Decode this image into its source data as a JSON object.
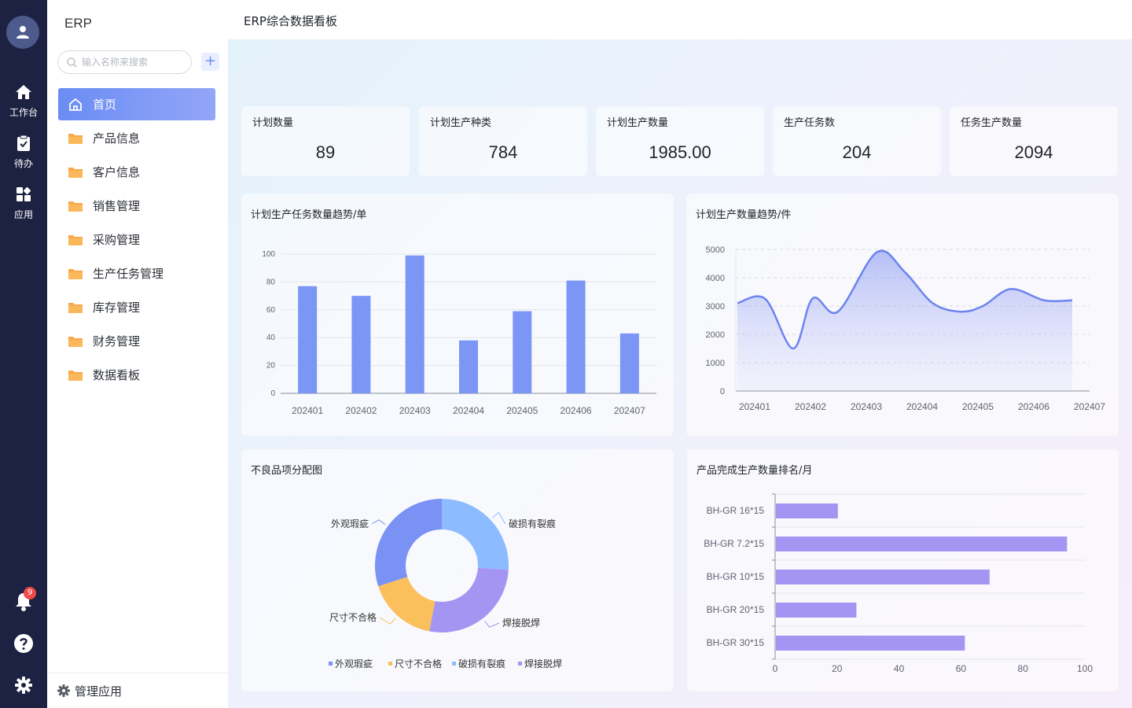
{
  "app": {
    "brand": "ERP",
    "page_title": "ERP综合数据看板"
  },
  "rail": {
    "items": [
      {
        "label": "工作台",
        "icon": "home-icon"
      },
      {
        "label": "待办",
        "icon": "clipboard-check-icon"
      },
      {
        "label": "应用",
        "icon": "apps-grid-icon"
      }
    ],
    "notification_count": "9",
    "bottom_icons": [
      "bell-icon",
      "help-icon",
      "settings-icon"
    ]
  },
  "sidebar": {
    "search_placeholder": "输入名称来搜索",
    "add_label": "+",
    "menu": [
      {
        "label": "首页",
        "icon": "home-outline-icon",
        "active": true
      },
      {
        "label": "产品信息",
        "icon": "folder-icon"
      },
      {
        "label": "客户信息",
        "icon": "folder-icon"
      },
      {
        "label": "销售管理",
        "icon": "folder-icon"
      },
      {
        "label": "采购管理",
        "icon": "folder-icon"
      },
      {
        "label": "生产任务管理",
        "icon": "folder-icon"
      },
      {
        "label": "库存管理",
        "icon": "folder-icon"
      },
      {
        "label": "财务管理",
        "icon": "folder-icon"
      },
      {
        "label": "数据看板",
        "icon": "folder-icon"
      }
    ],
    "manage_label": "管理应用"
  },
  "colors": {
    "accent": "#6a8cf4",
    "bar_blue": "#7b96f5",
    "bar_purple": "#a495f2",
    "rail": "#1d2142",
    "folder": "#f7a94b"
  },
  "stats": [
    {
      "label": "计划数量",
      "value": "89"
    },
    {
      "label": "计划生产种类",
      "value": "784"
    },
    {
      "label": "计划生产数量",
      "value": "1985.00"
    },
    {
      "label": "生产任务数",
      "value": "204"
    },
    {
      "label": "任务生产数量",
      "value": "2094"
    }
  ],
  "chart_data": [
    {
      "type": "bar",
      "title": "计划生产任务数量趋势/单",
      "categories": [
        "202401",
        "202402",
        "202403",
        "202404",
        "202405",
        "202406",
        "202407"
      ],
      "values": [
        77,
        70,
        99,
        38,
        59,
        81,
        43
      ],
      "ylim": [
        0,
        100
      ],
      "yticks": [
        "0",
        "20",
        "40",
        "60",
        "80",
        "100"
      ],
      "grid": true,
      "color": "#7b96f5"
    },
    {
      "type": "area",
      "title": "计划生产数量趋势/件",
      "categories": [
        "202401",
        "202402",
        "202403",
        "202404",
        "202405",
        "202406",
        "202407"
      ],
      "x": [
        1,
        1.5,
        2,
        2.35,
        2.8,
        3.5,
        4,
        4.5,
        5,
        5.4,
        5.9,
        6.5,
        7
      ],
      "y": [
        3100,
        3250,
        1500,
        3270,
        2800,
        4900,
        4200,
        3100,
        2800,
        3000,
        3600,
        3200,
        3200
      ],
      "ylim": [
        0,
        5000
      ],
      "yticks": [
        "0",
        "1000",
        "2000",
        "3000",
        "4000",
        "5000"
      ],
      "grid": true,
      "color": "#6c84ef"
    },
    {
      "type": "pie",
      "title": "不良品项分配图",
      "slices": [
        {
          "label": "破损有裂痕",
          "value": 26,
          "color": "#8dbbff"
        },
        {
          "label": "焊接脱焊",
          "value": 27,
          "color": "#a495f2"
        },
        {
          "label": "尺寸不合格",
          "value": 17,
          "color": "#fbbf5c"
        },
        {
          "label": "外观瑕疵",
          "value": 30,
          "color": "#7b92f5"
        }
      ],
      "legend": [
        "外观瑕疵",
        "尺寸不合格",
        "破损有裂痕",
        "焊接脱焊"
      ],
      "legend_position": "bottom"
    },
    {
      "type": "bar",
      "orientation": "horizontal",
      "title": "产品完成生产数量排名/月",
      "categories": [
        "BH-GR 16*15",
        "BH-GR 7.2*15",
        "BH-GR 10*15",
        "BH-GR 20*15",
        "BH-GR 30*15"
      ],
      "values": [
        20,
        94,
        69,
        26,
        61
      ],
      "xlim": [
        0,
        100
      ],
      "xticks": [
        "0",
        "20",
        "40",
        "60",
        "80",
        "100"
      ],
      "grid": true,
      "color": "#a495f2"
    }
  ]
}
